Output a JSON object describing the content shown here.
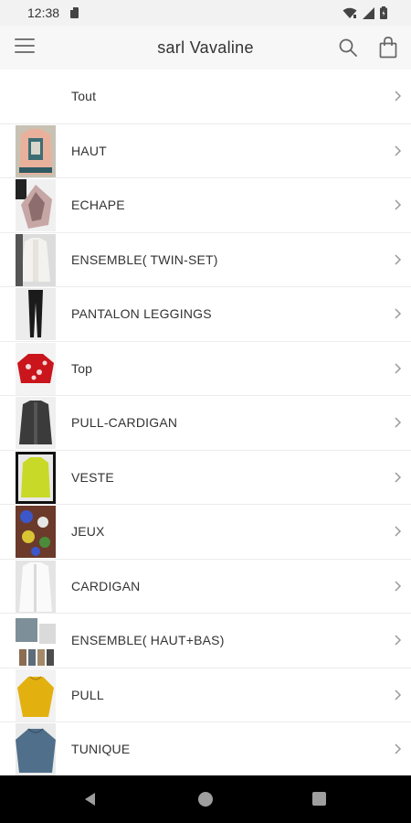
{
  "status_bar": {
    "time": "12:38"
  },
  "app_bar": {
    "title": "sarl Vavaline"
  },
  "categories": [
    {
      "label": "Tout",
      "thumb": "none"
    },
    {
      "label": "HAUT",
      "thumb": "peach sweater with print"
    },
    {
      "label": "ECHAPE",
      "thumb": "pink scarf"
    },
    {
      "label": "ENSEMBLE( TWIN-SET)",
      "thumb": "light knit set"
    },
    {
      "label": "PANTALON LEGGINGS",
      "thumb": "black leggings"
    },
    {
      "label": "Top",
      "thumb": "red floral top"
    },
    {
      "label": "PULL-CARDIGAN",
      "thumb": "grey cardigan"
    },
    {
      "label": "VESTE",
      "thumb": "yellow-green jacket"
    },
    {
      "label": "JEUX",
      "thumb": "fidget spinners"
    },
    {
      "label": "CARDIGAN",
      "thumb": "white cardigan"
    },
    {
      "label": "ENSEMBLE( HAUT+BAS)",
      "thumb": "set top and bottom"
    },
    {
      "label": "PULL",
      "thumb": "yellow pullover"
    },
    {
      "label": "TUNIQUE",
      "thumb": "blue tunic"
    }
  ],
  "colors": {
    "accent_text": "#333333",
    "nav_bar": "#000000",
    "app_bar": "#f7f7f7"
  }
}
